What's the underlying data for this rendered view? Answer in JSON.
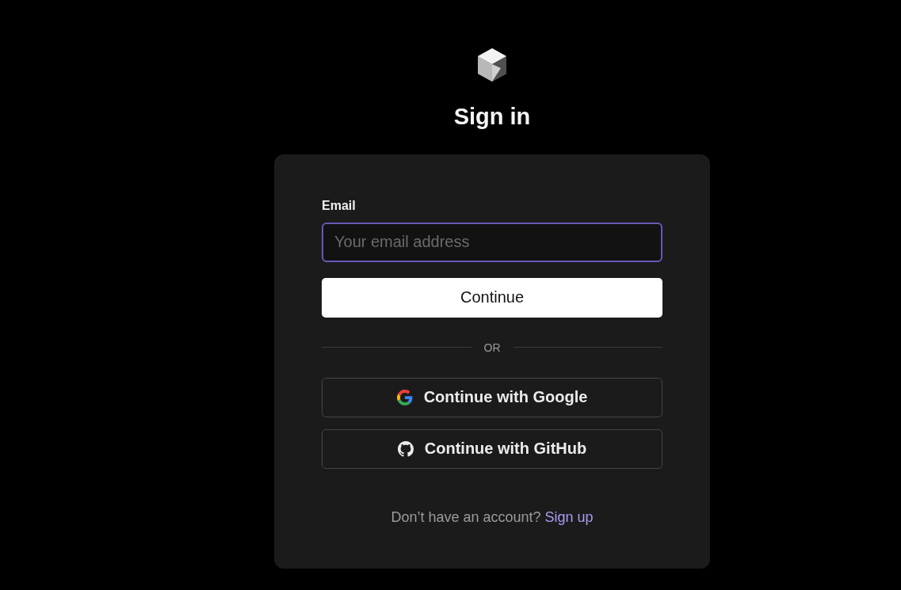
{
  "title": "Sign in",
  "form": {
    "email_label": "Email",
    "email_field": {
      "placeholder": "Your email address",
      "focused": true
    },
    "submit": "Continue"
  },
  "divider": "OR",
  "providers": [
    {
      "kind": "google",
      "label": "Continue with Google"
    },
    {
      "kind": "github",
      "label": "Continue with GitHub"
    }
  ],
  "footer": {
    "text": "Don’t have an account?",
    "link": "Sign up"
  }
}
